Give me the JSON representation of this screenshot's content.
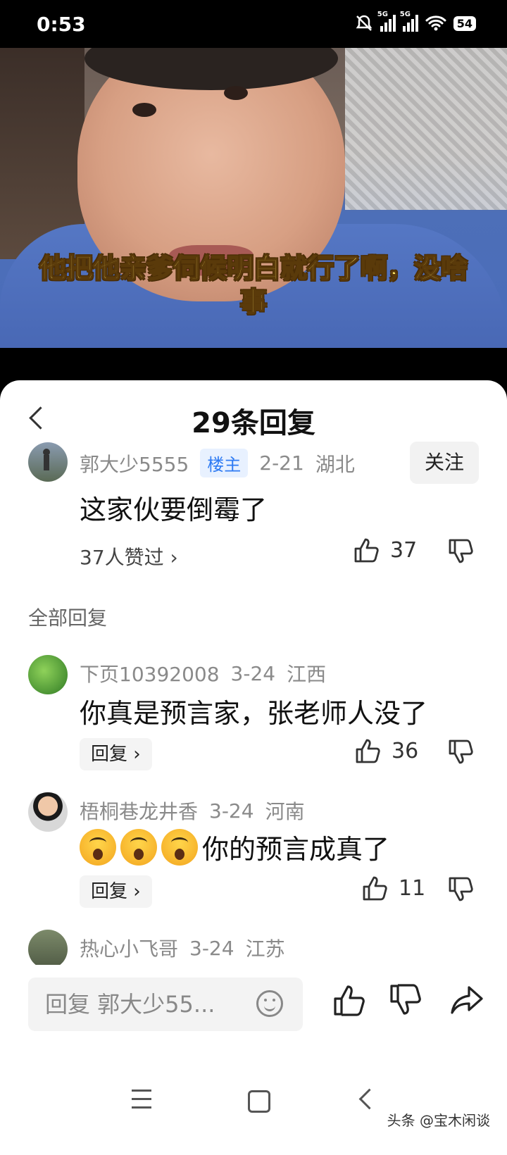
{
  "status_bar": {
    "time": "0:53",
    "battery": "54",
    "network": "5G"
  },
  "video": {
    "subtitle_line1": "他把他亲爹伺候明白就行了啊，没啥",
    "subtitle_line2": "事"
  },
  "panel": {
    "title": "29条回复"
  },
  "original_comment": {
    "username": "郭大少5555",
    "op_badge": "楼主",
    "date": "2-21",
    "location": "湖北",
    "follow_label": "关注",
    "text": "这家伙要倒霉了",
    "likers_text": "37人赞过 ›",
    "like_count": "37"
  },
  "all_replies_label": "全部回复",
  "replies": [
    {
      "username": "下页10392008",
      "date": "3-24",
      "location": "江西",
      "text": "你真是预言家，张老师人没了",
      "reply_label": "回复 ›",
      "like_count": "36"
    },
    {
      "username": "梧桐巷龙井香",
      "date": "3-24",
      "location": "河南",
      "text": "你的预言成真了",
      "reply_label": "回复 ›",
      "like_count": "11"
    },
    {
      "username": "热心小飞哥",
      "date": "3-24",
      "location": "江苏"
    }
  ],
  "input_bar": {
    "placeholder": "回复 郭大少55..."
  },
  "watermark": "头条 @宝木闲谈"
}
